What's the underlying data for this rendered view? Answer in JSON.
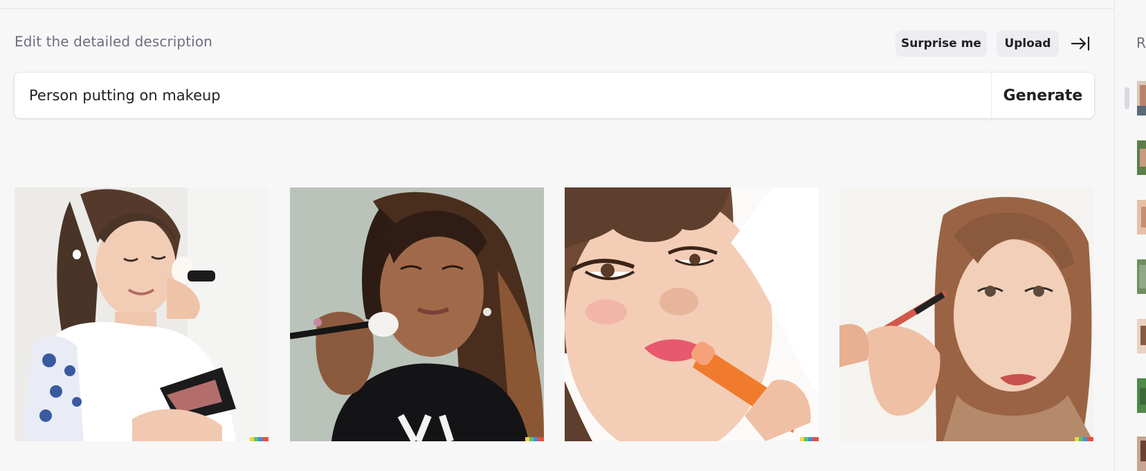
{
  "header": {
    "description_label": "Edit the detailed description",
    "surprise_label": "Surprise me",
    "upload_label": "Upload",
    "collapse_icon": "arrow-to-right-bar-icon"
  },
  "prompt": {
    "value": "Person putting on makeup",
    "generate_label": "Generate"
  },
  "results": [
    {
      "subject": "woman-applying-powder-puff"
    },
    {
      "subject": "woman-applying-brush"
    },
    {
      "subject": "woman-applying-lipstick"
    },
    {
      "subject": "woman-applying-eye-pencil"
    }
  ],
  "sidebar": {
    "heading_partial": "R",
    "thumbnails": 7
  },
  "colors": {
    "page_bg": "#f7f7f8",
    "pill_bg": "#ececf1",
    "text_primary": "#202123",
    "text_secondary": "#6e6e80"
  }
}
